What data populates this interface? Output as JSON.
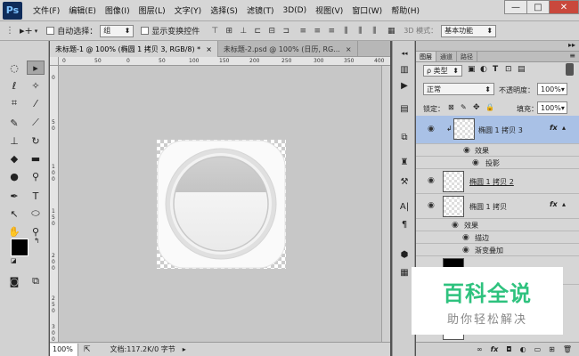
{
  "app": {
    "logo": "Ps"
  },
  "menu": [
    "文件(F)",
    "编辑(E)",
    "图像(I)",
    "图层(L)",
    "文字(Y)",
    "选择(S)",
    "滤镜(T)",
    "3D(D)",
    "视图(V)",
    "窗口(W)",
    "帮助(H)"
  ],
  "window_controls": {
    "minimize": "—",
    "maximize": "□",
    "close": "✕"
  },
  "options": {
    "auto_select_label": "自动选择：",
    "auto_select_value": "组",
    "show_transform_label": "显示变换控件",
    "mode_3d": "3D 模式：",
    "workspace": "基本功能"
  },
  "tabs": [
    {
      "label": "未标题-1 @ 100% (椭圆 1 拷贝 3, RGB/8) *",
      "close": "×"
    },
    {
      "label": "未标题-2.psd @ 100% (日历, RG...",
      "close": "×"
    }
  ],
  "ruler": {
    "h": [
      "0",
      "50",
      "0",
      "50",
      "100",
      "150",
      "200",
      "250",
      "300",
      "350",
      "400"
    ],
    "v": [
      "0",
      "5",
      "0",
      "1",
      "0",
      "0",
      "1",
      "5",
      "0",
      "2",
      "0",
      "0",
      "2",
      "5",
      "0",
      "3",
      "0",
      "0"
    ]
  },
  "status": {
    "zoom": "100%",
    "doc": "文档:117.2K/0 字节"
  },
  "layers_panel": {
    "tabs": [
      "图层",
      "通道",
      "路径"
    ],
    "filter": "ρ 类型",
    "blend": "正常",
    "opacity_label": "不透明度：",
    "opacity": "100%",
    "lock_label": "锁定：",
    "fill_label": "填充：",
    "fill": "100%",
    "layers": [
      {
        "name": "椭圆 1 拷贝 3",
        "fx": "fx",
        "effects_label": "效果",
        "effects": [
          "投影"
        ]
      },
      {
        "name": "椭圆 1 拷贝 2",
        "fx": "",
        "effects_label": "",
        "effects": []
      },
      {
        "name": "椭圆 1 拷贝",
        "fx": "fx",
        "effects_label": "效果",
        "effects": [
          "描边",
          "渐变叠加"
        ]
      }
    ],
    "bottom_icons": [
      "∞",
      "fx",
      "◘",
      "◐",
      "▭",
      "⊞",
      "🗑"
    ]
  },
  "watermark": {
    "main": "百科全说",
    "sub": "助你轻松解决"
  },
  "colors": {
    "accent": "#2ec27e",
    "selected_layer": "#a9c1e6"
  }
}
